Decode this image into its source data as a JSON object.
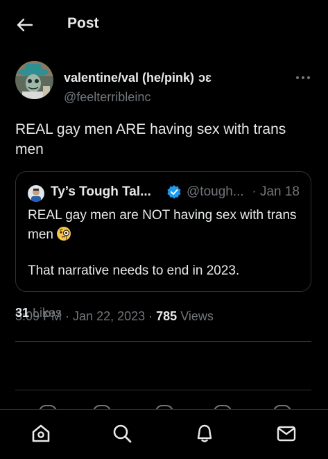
{
  "header": {
    "title": "Post",
    "back_icon": "arrow-left-icon"
  },
  "post": {
    "author": {
      "name": "valentine/val (he/pink)",
      "name_emoji": "ɔɛ",
      "handle": "@feelterribleinc"
    },
    "text": "REAL gay men ARE having sex with trans men",
    "quoted": {
      "name": "Ty’s Tough Tal...",
      "handle": "@tough...",
      "date": "· Jan 18",
      "line1": "REAL gay men are NOT having sex with trans men",
      "line2": "That narrative needs to end in 2023.",
      "emoji_icon": "face-with-monocle-icon"
    },
    "time": "3:09 PM",
    "sep1": " · ",
    "date": "Jan 22, 2023",
    "sep2": " · ",
    "views_count": "785",
    "views_label": " Views",
    "likes_count": "31",
    "likes_label": " Likes"
  },
  "nav": {
    "items": [
      "home-icon",
      "search-icon",
      "notifications-icon",
      "messages-icon"
    ]
  },
  "colors": {
    "background": "#000000",
    "text": "#e7e9ea",
    "secondary": "#71767b",
    "border": "#2f3336",
    "verified": "#1d9bf0"
  }
}
